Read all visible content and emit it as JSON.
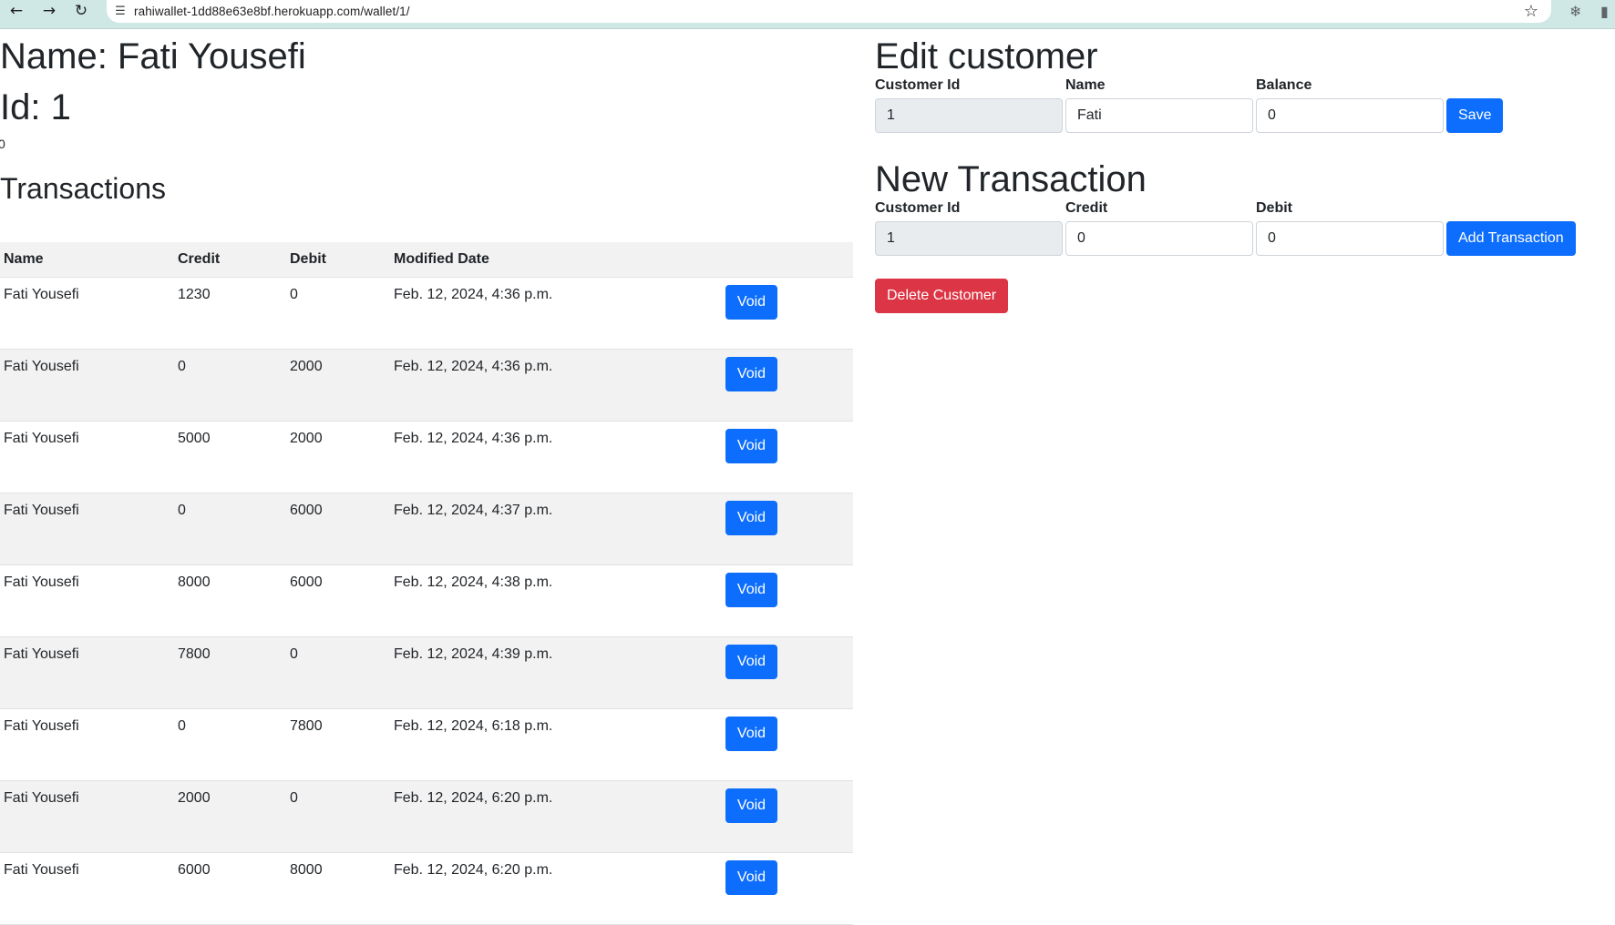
{
  "browser": {
    "url": "rahiwallet-1dd88e63e8bf.herokuapp.com/wallet/1/"
  },
  "customer": {
    "name_heading": "Name: Fati Yousefi",
    "id_heading": "Id: 1",
    "balance": "0"
  },
  "transactions": {
    "heading": "Transactions",
    "columns": [
      "Name",
      "Credit",
      "Debit",
      "Modified Date"
    ],
    "void_label": "Void",
    "rows": [
      {
        "name": "Fati Yousefi",
        "credit": "1230",
        "debit": "0",
        "date": "Feb. 12, 2024, 4:36 p.m."
      },
      {
        "name": "Fati Yousefi",
        "credit": "0",
        "debit": "2000",
        "date": "Feb. 12, 2024, 4:36 p.m."
      },
      {
        "name": "Fati Yousefi",
        "credit": "5000",
        "debit": "2000",
        "date": "Feb. 12, 2024, 4:36 p.m."
      },
      {
        "name": "Fati Yousefi",
        "credit": "0",
        "debit": "6000",
        "date": "Feb. 12, 2024, 4:37 p.m."
      },
      {
        "name": "Fati Yousefi",
        "credit": "8000",
        "debit": "6000",
        "date": "Feb. 12, 2024, 4:38 p.m."
      },
      {
        "name": "Fati Yousefi",
        "credit": "7800",
        "debit": "0",
        "date": "Feb. 12, 2024, 4:39 p.m."
      },
      {
        "name": "Fati Yousefi",
        "credit": "0",
        "debit": "7800",
        "date": "Feb. 12, 2024, 6:18 p.m."
      },
      {
        "name": "Fati Yousefi",
        "credit": "2000",
        "debit": "0",
        "date": "Feb. 12, 2024, 6:20 p.m."
      },
      {
        "name": "Fati Yousefi",
        "credit": "6000",
        "debit": "8000",
        "date": "Feb. 12, 2024, 6:20 p.m."
      }
    ]
  },
  "edit_customer": {
    "heading": "Edit customer",
    "customer_id_label": "Customer Id",
    "customer_id_value": "1",
    "name_label": "Name",
    "name_value": "Fati",
    "balance_label": "Balance",
    "balance_value": "0",
    "save_label": "Save"
  },
  "new_transaction": {
    "heading": "New Transaction",
    "customer_id_label": "Customer Id",
    "customer_id_value": "1",
    "credit_label": "Credit",
    "credit_value": "0",
    "debit_label": "Debit",
    "debit_value": "0",
    "add_label": "Add Transaction"
  },
  "delete_label": "Delete Customer",
  "colors": {
    "primary": "#0d6efd",
    "danger": "#dc3545",
    "chrome": "#cfe8e5",
    "stripe": "#f2f2f2"
  }
}
